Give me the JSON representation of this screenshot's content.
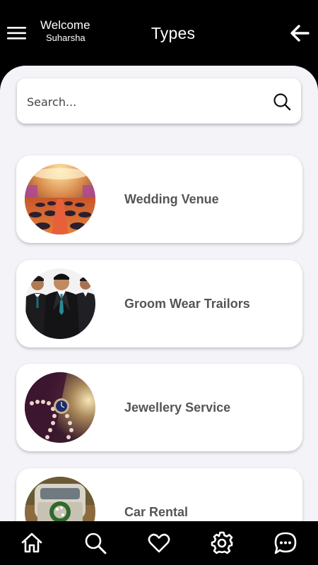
{
  "header": {
    "welcome": "Welcome",
    "username": "Suharsha",
    "title": "Types"
  },
  "search": {
    "placeholder": "Search...",
    "value": ""
  },
  "types": [
    {
      "label": "Wedding Venue",
      "image": "wedding-venue-hall"
    },
    {
      "label": "Groom Wear Trailors",
      "image": "groom-wear-suits"
    },
    {
      "label": "Jewellery Service",
      "image": "jewellery-watch-pearls"
    },
    {
      "label": "Car Rental",
      "image": "decorated-wedding-car"
    }
  ],
  "bottom_nav": [
    {
      "name": "home",
      "icon": "home-icon"
    },
    {
      "name": "search",
      "icon": "search-icon"
    },
    {
      "name": "favorites",
      "icon": "heart-icon"
    },
    {
      "name": "settings",
      "icon": "gear-icon"
    },
    {
      "name": "chat",
      "icon": "chat-bubble-icon"
    }
  ],
  "colors": {
    "header_bg": "#000000",
    "content_bg": "#f4f3f8",
    "card_bg": "#ffffff",
    "label_text": "#555555"
  }
}
